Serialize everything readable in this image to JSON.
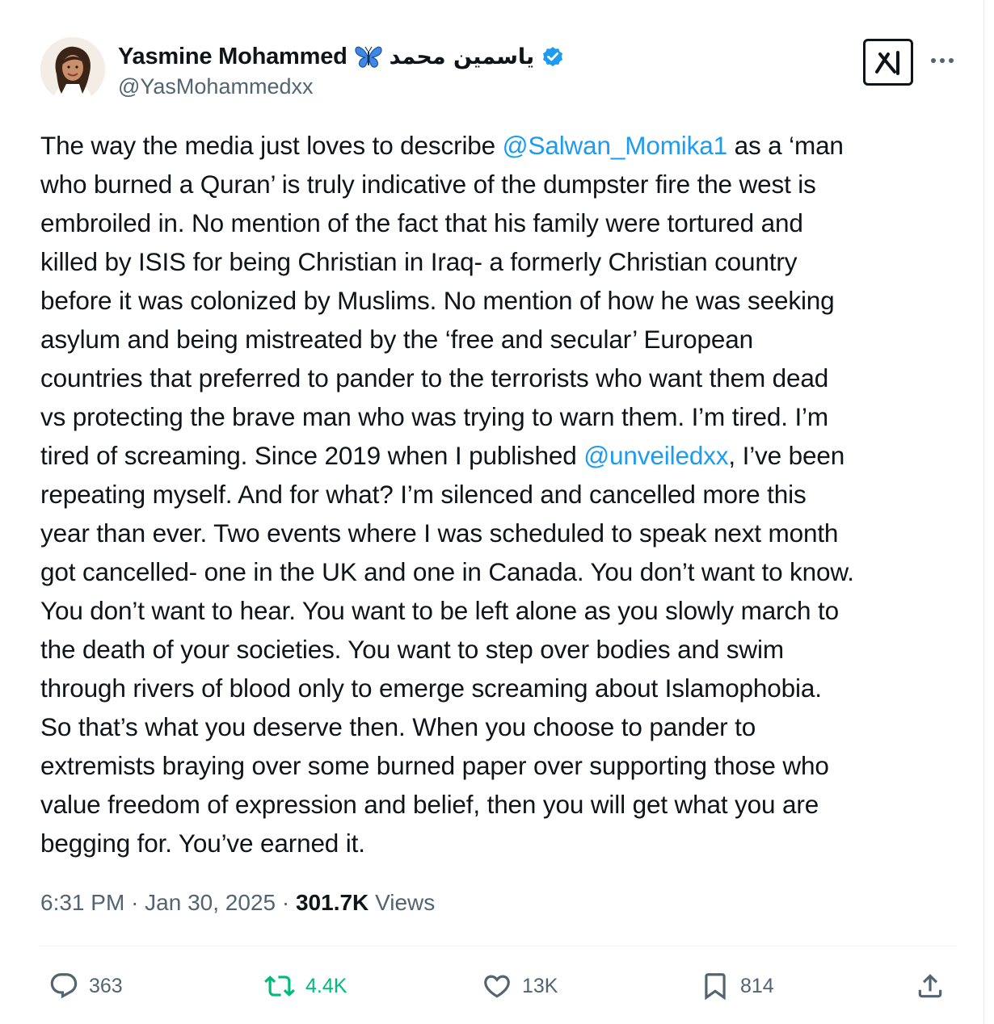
{
  "author": {
    "display_name": "Yasmine Mohammed",
    "arabic_name": "ياسمين محمد",
    "handle": "@YasMohammedxx",
    "verified": true,
    "emoji_icon": "butterfly-icon"
  },
  "colors": {
    "link": "#1d9bf0",
    "text": "#0f1419",
    "muted": "#536471",
    "retweet_active": "#00ba7c"
  },
  "tweet": {
    "lines": [
      [
        {
          "t": "The way the media just loves to describe "
        },
        {
          "t": "@Salwan_Momika1",
          "mention": true
        },
        {
          "t": " as a ‘man"
        }
      ],
      [
        {
          "t": "who burned a Quran’ is truly indicative of the dumpster fire the west is"
        }
      ],
      [
        {
          "t": "embroiled in. No mention of the fact that his family were tortured and"
        }
      ],
      [
        {
          "t": "killed by ISIS for being Christian in Iraq- a formerly Christian country"
        }
      ],
      [
        {
          "t": "before it was colonized by Muslims. No mention of how he was seeking"
        }
      ],
      [
        {
          "t": "asylum and being mistreated by the ‘free and secular’ European"
        }
      ],
      [
        {
          "t": "countries that preferred to pander to the terrorists who want them dead"
        }
      ],
      [
        {
          "t": "vs protecting the brave man who was trying to warn them. I’m tired. I’m"
        }
      ],
      [
        {
          "t": "tired of screaming. Since 2019 when I published "
        },
        {
          "t": "@unveiledxx",
          "mention": true
        },
        {
          "t": ", I’ve been"
        }
      ],
      [
        {
          "t": "repeating myself. And for what? I’m silenced and cancelled more this"
        }
      ],
      [
        {
          "t": "year than ever. Two events where I was scheduled to speak next month"
        }
      ],
      [
        {
          "t": "got cancelled- one in the UK and one in Canada. You don’t want to know."
        }
      ],
      [
        {
          "t": "You don’t want to hear. You want to be left alone as you slowly march to"
        }
      ],
      [
        {
          "t": "the death of your societies. You want to step over bodies and swim"
        }
      ],
      [
        {
          "t": "through rivers of blood only to emerge screaming about Islamophobia."
        }
      ],
      [
        {
          "t": "So that’s what you deserve then. When you choose to pander to"
        }
      ],
      [
        {
          "t": "extremists braying over some burned paper over supporting those who"
        }
      ],
      [
        {
          "t": "value freedom of expression and belief, then you will get what you are"
        }
      ],
      [
        {
          "t": "begging for. You’ve earned it."
        }
      ]
    ]
  },
  "meta": {
    "time": "6:31 PM",
    "separator": "·",
    "date": "Jan 30, 2025",
    "views_count": "301.7K",
    "views_label": "Views"
  },
  "actions": {
    "replies": "363",
    "reposts": "4.4K",
    "likes": "13K",
    "bookmarks": "814"
  },
  "icons": {
    "grok": "grok-icon",
    "more": "more-dots-icon",
    "reply": "reply-icon",
    "repost": "repost-icon",
    "like": "heart-icon",
    "bookmark": "bookmark-icon",
    "share": "share-icon"
  }
}
